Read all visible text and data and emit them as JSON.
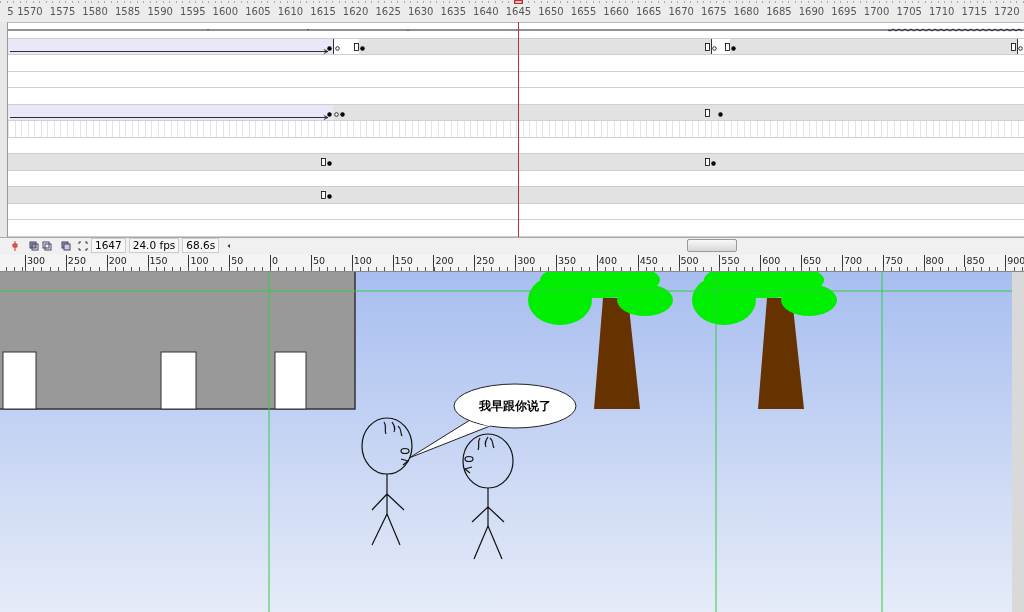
{
  "timeline": {
    "frame_ruler": {
      "labels": [
        "5",
        "1570",
        "1575",
        "1580",
        "1585",
        "1590",
        "1595",
        "1600",
        "1605",
        "1610",
        "1615",
        "1620",
        "1625",
        "1630",
        "1635",
        "1640",
        "1645",
        "1650",
        "1655",
        "1660",
        "1665",
        "1670",
        "1675",
        "1680",
        "1685",
        "1690",
        "1695",
        "1700",
        "1705",
        "1710",
        "1715",
        "1720"
      ]
    },
    "layers": [
      {
        "kind": "audio"
      },
      {
        "kind": "frames",
        "spans": [
          {
            "kind": "tween"
          },
          {
            "kind": "blank"
          },
          {
            "kind": "static"
          },
          {
            "kind": "blank"
          },
          {
            "kind": "static"
          },
          {
            "kind": "blank"
          }
        ],
        "keys": [
          {
            "kind": "filled"
          },
          {
            "kind": "hollow"
          },
          {
            "kind": "end"
          },
          {
            "kind": "filled"
          },
          {
            "kind": "end"
          },
          {
            "kind": "hollow"
          },
          {
            "kind": "end"
          },
          {
            "kind": "filled"
          },
          {
            "kind": "end"
          },
          {
            "kind": "hollow"
          }
        ]
      },
      {
        "kind": "empty"
      },
      {
        "kind": "empty"
      },
      {
        "kind": "empty"
      },
      {
        "kind": "frames",
        "spans": [
          {
            "kind": "tween"
          },
          {
            "kind": "static"
          }
        ],
        "keys": [
          {
            "kind": "filled"
          },
          {
            "kind": "hollow"
          },
          {
            "kind": "filled"
          },
          {
            "kind": "end"
          },
          {
            "kind": "filled"
          }
        ]
      },
      {
        "kind": "ticks"
      },
      {
        "kind": "empty"
      },
      {
        "kind": "frames",
        "spans": [
          {
            "kind": "static"
          }
        ],
        "keys": [
          {
            "kind": "end"
          },
          {
            "kind": "filled"
          },
          {
            "kind": "end"
          },
          {
            "kind": "filled"
          }
        ]
      },
      {
        "kind": "empty"
      },
      {
        "kind": "frames",
        "spans": [
          {
            "kind": "static"
          }
        ],
        "keys": [
          {
            "kind": "end"
          },
          {
            "kind": "filled"
          }
        ]
      },
      {
        "kind": "empty"
      },
      {
        "kind": "empty"
      }
    ]
  },
  "status_bar": {
    "current_frame": "1647",
    "frame_rate": "24.0 fps",
    "elapsed_time": "68.6s"
  },
  "stage": {
    "ruler_labels": [
      "300",
      "250",
      "200",
      "150",
      "100",
      "50",
      "0",
      "50",
      "100",
      "150",
      "200",
      "250",
      "300",
      "350",
      "400",
      "450",
      "500",
      "550",
      "600",
      "650",
      "700",
      "750",
      "800",
      "850",
      "900"
    ],
    "speech_bubble": {
      "text": "我早跟你说了"
    }
  }
}
